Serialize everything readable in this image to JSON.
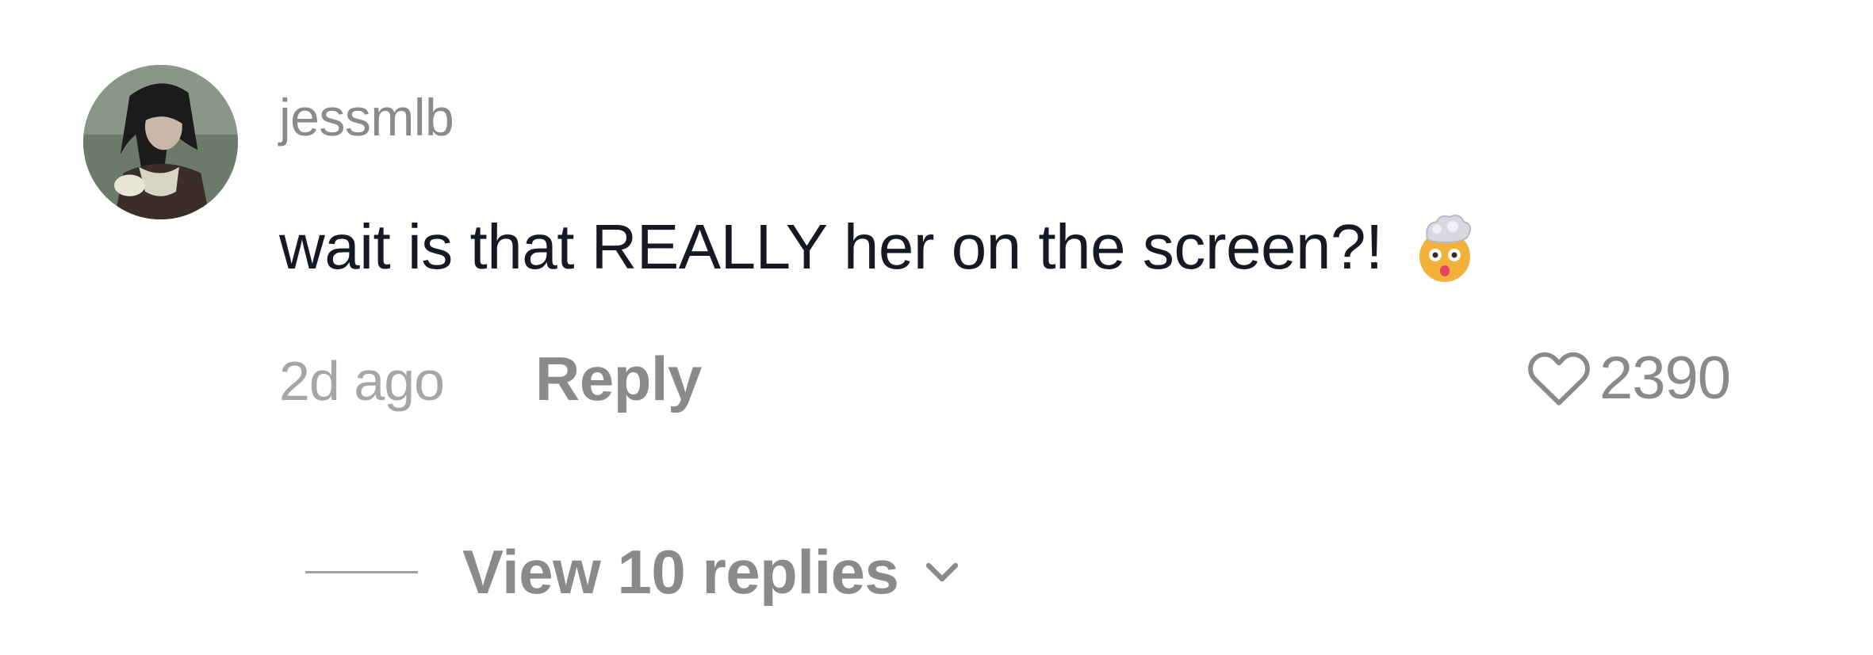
{
  "comment": {
    "username": "jessmlb",
    "text": "wait is that REALLY her on the screen?!",
    "emoji": "exploding-head-icon",
    "timestamp": "2d ago",
    "reply_label": "Reply",
    "like_icon": "heart-outline-icon",
    "like_count": "2390",
    "view_replies_label": "View 10 replies",
    "view_replies_icon": "chevron-down-icon"
  },
  "colors": {
    "primary_text": "#161823",
    "secondary_text": "#8a8a8a",
    "muted_text": "#a6a6a6",
    "background": "#ffffff"
  }
}
